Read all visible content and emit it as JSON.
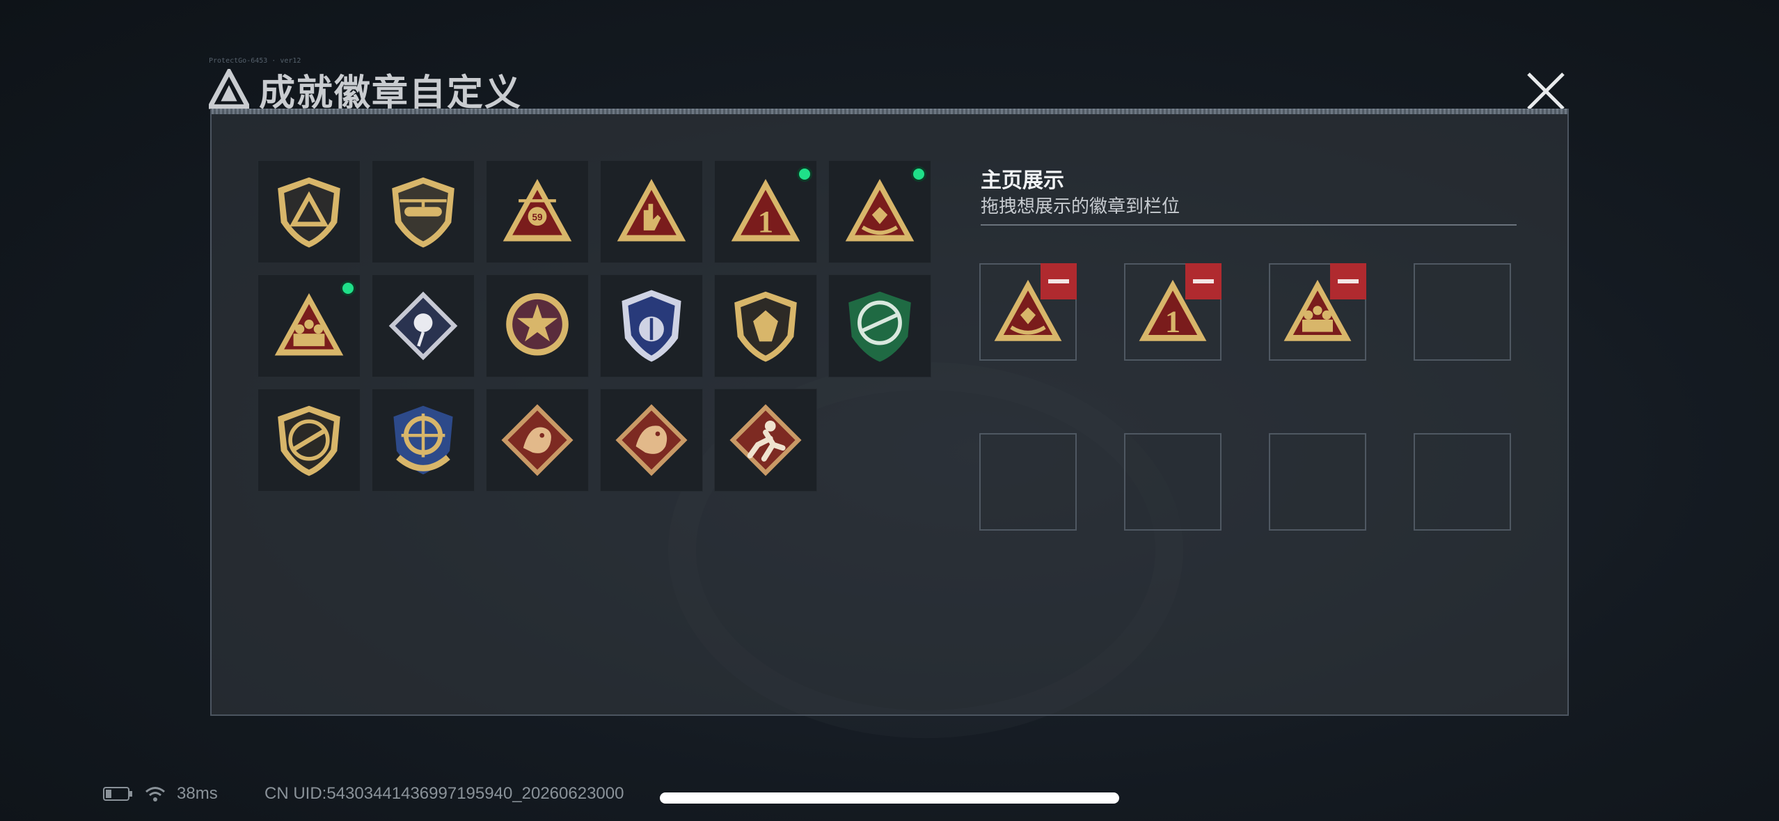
{
  "window": {
    "title": "成就徽章自定义",
    "tiny_label": "ProtectGo-6453 · ver12"
  },
  "badges": [
    {
      "icon": "shield-logo-badge-icon",
      "equipped": false
    },
    {
      "icon": "helicopter-shield-badge-icon",
      "equipped": false
    },
    {
      "icon": "chopper-59-badge-icon",
      "equipped": false
    },
    {
      "icon": "rock-hand-triangle-badge-icon",
      "equipped": false
    },
    {
      "icon": "number-one-triangle-badge-icon",
      "equipped": true
    },
    {
      "icon": "hands-gem-triangle-badge-icon",
      "equipped": true
    },
    {
      "icon": "squad-triangle-badge-icon",
      "equipped": true
    },
    {
      "icon": "rose-diamond-badge-icon",
      "equipped": false
    },
    {
      "icon": "star-medallion-badge-icon",
      "equipped": false
    },
    {
      "icon": "blue-shield-badge-icon",
      "equipped": false
    },
    {
      "icon": "gem-shield-badge-icon",
      "equipped": false
    },
    {
      "icon": "green-rifle-badge-icon",
      "equipped": false
    },
    {
      "icon": "rifle-shield-badge-icon",
      "equipped": false
    },
    {
      "icon": "crosshair-wreath-badge-icon",
      "equipped": false
    },
    {
      "icon": "dragon-diamond-badge-icon",
      "equipped": false
    },
    {
      "icon": "dragon-diamond-2-badge-icon",
      "equipped": false
    },
    {
      "icon": "runner-diamond-badge-icon",
      "equipped": false
    }
  ],
  "showcase": {
    "title": "主页展示",
    "subtitle": "拖拽想展示的徽章到栏位",
    "slots": [
      {
        "badge": "hands-gem-triangle-badge-icon"
      },
      {
        "badge": "number-one-triangle-badge-icon"
      },
      {
        "badge": "squad-triangle-badge-icon"
      },
      {
        "badge": null
      },
      {
        "badge": null
      },
      {
        "badge": null
      },
      {
        "badge": null
      },
      {
        "badge": null
      }
    ]
  },
  "status": {
    "ping": "38ms",
    "uid": "CN UID:5430344143699719594​0_20260623000"
  },
  "colors": {
    "equipped_dot": "#1fe089",
    "remove_button": "#b02a2f",
    "badge_gold": "#d8b66a",
    "badge_red": "#7a1c1c"
  }
}
